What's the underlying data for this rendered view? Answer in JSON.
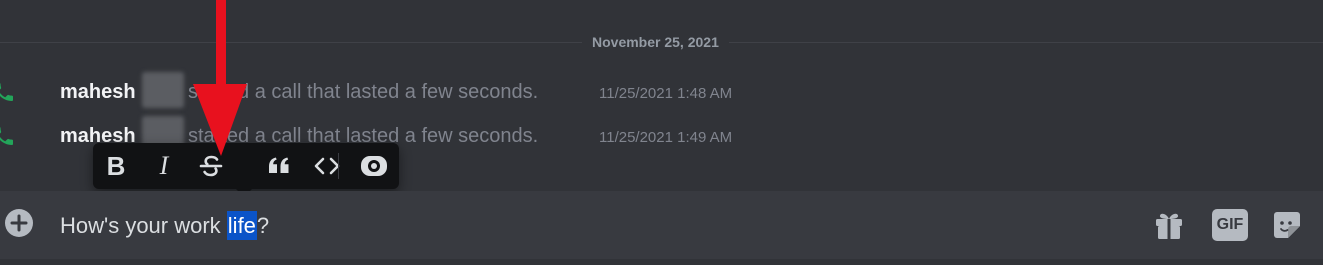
{
  "date_divider": "November 25, 2021",
  "call_log": [
    {
      "user": "mahesh",
      "message": "started a call that lasted a few seconds.",
      "timestamp": "11/25/2021 1:48 AM"
    },
    {
      "user": "mahesh",
      "message": "started a call that lasted a few seconds.",
      "timestamp": "11/25/2021 1:49 AM"
    }
  ],
  "format_toolbar": {
    "buttons": [
      "bold-icon",
      "italic-icon",
      "strikethrough-icon",
      "quote-icon",
      "code-icon",
      "spoiler-icon"
    ],
    "bold_label": "B",
    "italic_label": "I"
  },
  "composer": {
    "text_before": "How's your work ",
    "selected_text": "life",
    "text_after": "?",
    "gif_label": "GIF"
  },
  "colors": {
    "background": "#313338",
    "composer": "#383a40",
    "toolbar": "#111214",
    "phone_icon": "#23a55a",
    "selection": "#0b54c8",
    "arrow": "#e8111e"
  }
}
